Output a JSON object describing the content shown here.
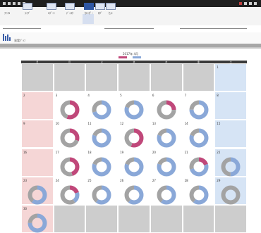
{
  "window": {
    "toolbar_left": [
      "",
      "",
      "",
      "",
      "",
      "",
      ""
    ],
    "toolbar_right": [
      "",
      "",
      "",
      ""
    ]
  },
  "ribbon": {
    "tabs": [
      {
        "label": "ﾌｧｲﾙ",
        "selected": false
      },
      {
        "label": "ﾗｲﾌﾞ",
        "selected": false
      },
      {
        "label": "ﾚﾎﾟｰﾄ",
        "selected": false
      },
      {
        "label": "ﾃﾞｨｽｸ",
        "selected": false
      },
      {
        "label": "ｶﾚﾝﾀﾞｰ",
        "selected": true
      },
      {
        "label": "ﾛｸﾞ",
        "selected": false
      },
      {
        "label": "ｾｯﾄ",
        "selected": false
      }
    ]
  },
  "view": {
    "bar_label": "発電ｸﾞﾗﾌ"
  },
  "calendar": {
    "title": "2017年 4月",
    "legend": [
      {
        "label": "",
        "color": "#c0487a"
      },
      {
        "label": "",
        "color": "#8aa8d8"
      }
    ],
    "colors": {
      "primary": "#c0487a",
      "secondary": "#8aa8d8",
      "neutral": "#a3a3a3"
    },
    "day_headers": [
      "日",
      "月",
      "火",
      "水",
      "木",
      "金",
      "土"
    ],
    "weeks": [
      [
        {
          "date": "",
          "type": "out"
        },
        {
          "date": "",
          "type": "out"
        },
        {
          "date": "",
          "type": "out"
        },
        {
          "date": "",
          "type": "out"
        },
        {
          "date": "",
          "type": "out"
        },
        {
          "date": "",
          "type": "out"
        },
        {
          "date": "1",
          "type": "sat"
        }
      ],
      [
        {
          "date": "2",
          "type": "sun"
        },
        {
          "date": "3",
          "type": "day",
          "label": "",
          "segments": [
            {
              "c": "primary",
              "v": 0.55
            },
            {
              "c": "neutral",
              "v": 0.45
            }
          ]
        },
        {
          "date": "4",
          "type": "day",
          "label": "",
          "segments": [
            {
              "c": "secondary",
              "v": 0.7
            },
            {
              "c": "neutral",
              "v": 0.3
            }
          ]
        },
        {
          "date": "5",
          "type": "day",
          "label": "",
          "segments": [
            {
              "c": "secondary",
              "v": 0.8
            },
            {
              "c": "neutral",
              "v": 0.2
            }
          ]
        },
        {
          "date": "6",
          "type": "day",
          "label": "",
          "segments": [
            {
              "c": "primary",
              "v": 0.25
            },
            {
              "c": "neutral",
              "v": 0.75
            }
          ]
        },
        {
          "date": "7",
          "type": "day",
          "label": "",
          "segments": [
            {
              "c": "secondary",
              "v": 0.75
            },
            {
              "c": "neutral",
              "v": 0.25
            }
          ]
        },
        {
          "date": "8",
          "type": "sat"
        }
      ],
      [
        {
          "date": "9",
          "type": "sun"
        },
        {
          "date": "10",
          "type": "day",
          "label": "",
          "segments": [
            {
              "c": "primary",
              "v": 0.3
            },
            {
              "c": "neutral",
              "v": 0.7
            }
          ]
        },
        {
          "date": "11",
          "type": "day",
          "label": "",
          "segments": [
            {
              "c": "secondary",
              "v": 0.8
            },
            {
              "c": "neutral",
              "v": 0.2
            }
          ]
        },
        {
          "date": "12",
          "type": "day",
          "label": "",
          "segments": [
            {
              "c": "primary",
              "v": 0.55
            },
            {
              "c": "neutral",
              "v": 0.45
            }
          ]
        },
        {
          "date": "13",
          "type": "day",
          "label": "",
          "segments": [
            {
              "c": "secondary",
              "v": 0.8
            },
            {
              "c": "neutral",
              "v": 0.2
            }
          ]
        },
        {
          "date": "14",
          "type": "day",
          "label": "",
          "segments": [
            {
              "c": "secondary",
              "v": 0.8
            },
            {
              "c": "neutral",
              "v": 0.2
            }
          ]
        },
        {
          "date": "15",
          "type": "sat"
        }
      ],
      [
        {
          "date": "16",
          "type": "sun"
        },
        {
          "date": "17",
          "type": "day",
          "label": "",
          "segments": [
            {
              "c": "primary",
              "v": 0.45
            },
            {
              "c": "neutral",
              "v": 0.55
            }
          ]
        },
        {
          "date": "18",
          "type": "day",
          "label": "",
          "segments": [
            {
              "c": "secondary",
              "v": 0.8
            },
            {
              "c": "neutral",
              "v": 0.2
            }
          ]
        },
        {
          "date": "19",
          "type": "day",
          "label": "",
          "segments": [
            {
              "c": "secondary",
              "v": 0.8
            },
            {
              "c": "neutral",
              "v": 0.2
            }
          ]
        },
        {
          "date": "20",
          "type": "day",
          "label": "",
          "segments": [
            {
              "c": "secondary",
              "v": 0.8
            },
            {
              "c": "neutral",
              "v": 0.2
            }
          ]
        },
        {
          "date": "21",
          "type": "day",
          "label": "",
          "segments": [
            {
              "c": "primary",
              "v": 0.2
            },
            {
              "c": "secondary",
              "v": 0.5
            },
            {
              "c": "neutral",
              "v": 0.3
            }
          ]
        },
        {
          "date": "22",
          "type": "sat",
          "label": "",
          "segments": [
            {
              "c": "secondary",
              "v": 0.5
            },
            {
              "c": "neutral",
              "v": 0.5
            }
          ]
        }
      ],
      [
        {
          "date": "23",
          "type": "sun",
          "label": "",
          "segments": [
            {
              "c": "secondary",
              "v": 0.6
            },
            {
              "c": "neutral",
              "v": 0.4
            }
          ]
        },
        {
          "date": "24",
          "type": "day",
          "label": "",
          "segments": [
            {
              "c": "primary",
              "v": 0.2
            },
            {
              "c": "secondary",
              "v": 0.2
            },
            {
              "c": "neutral",
              "v": 0.6
            }
          ]
        },
        {
          "date": "25",
          "type": "day",
          "label": "",
          "segments": [
            {
              "c": "secondary",
              "v": 0.6
            },
            {
              "c": "neutral",
              "v": 0.4
            }
          ]
        },
        {
          "date": "26",
          "type": "day",
          "label": "",
          "segments": [
            {
              "c": "secondary",
              "v": 0.6
            },
            {
              "c": "neutral",
              "v": 0.4
            }
          ]
        },
        {
          "date": "27",
          "type": "day",
          "label": "",
          "segments": [
            {
              "c": "secondary",
              "v": 0.6
            },
            {
              "c": "neutral",
              "v": 0.4
            }
          ]
        },
        {
          "date": "28",
          "type": "day",
          "label": "",
          "segments": [
            {
              "c": "secondary",
              "v": 0.6
            },
            {
              "c": "neutral",
              "v": 0.4
            }
          ]
        },
        {
          "date": "29",
          "type": "sat",
          "label": "",
          "segments": [
            {
              "c": "neutral",
              "v": 1.0
            }
          ]
        }
      ],
      [
        {
          "date": "30",
          "type": "sun",
          "label": "",
          "segments": [
            {
              "c": "secondary",
              "v": 0.75
            },
            {
              "c": "neutral",
              "v": 0.25
            }
          ]
        },
        {
          "date": "",
          "type": "out"
        },
        {
          "date": "",
          "type": "out"
        },
        {
          "date": "",
          "type": "out"
        },
        {
          "date": "",
          "type": "out"
        },
        {
          "date": "",
          "type": "out"
        },
        {
          "date": "",
          "type": "out"
        }
      ]
    ]
  }
}
